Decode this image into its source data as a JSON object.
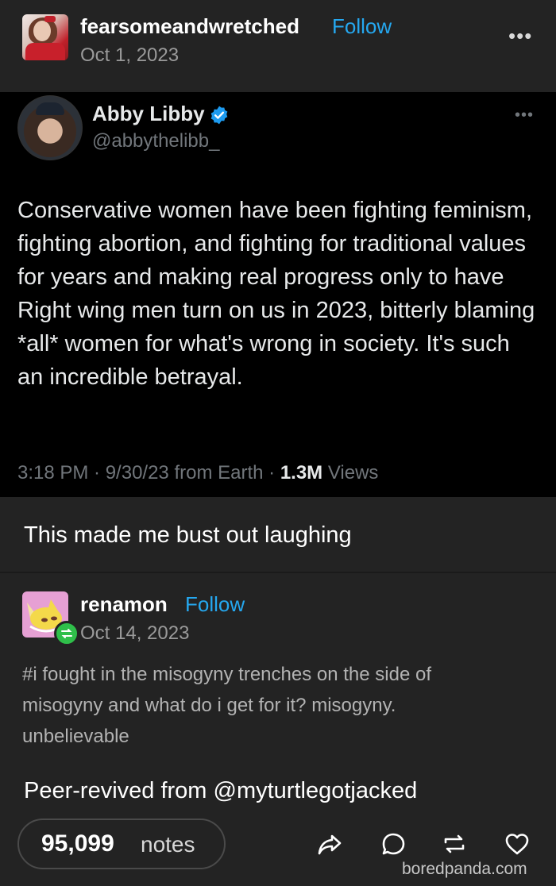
{
  "original_post": {
    "username": "fearsomeandwretched",
    "follow_label": "Follow",
    "date": "Oct 1, 2023",
    "menu_icon": "more-dots-icon"
  },
  "tweet": {
    "display_name": "Abby Libby",
    "handle": "@abbythelibb_",
    "verified_icon": "verified-badge-icon",
    "body": "Conservative women have been fighting feminism, fighting abortion, and fighting for traditional values for years and making real progress only to have Right wing men turn on us in 2023, bitterly blaming *all* women for what's wrong in society. It's such an incredible betrayal.",
    "time_date": "3:18 PM · 9/30/23 from Earth · ",
    "views_count": "1.3M",
    "views_label": " Views"
  },
  "caption": "This made me bust out laughing",
  "reblog": {
    "username": "renamon",
    "follow_label": "Follow",
    "date": "Oct 14, 2023",
    "tags": "#i fought in the misogyny trenches on the side of misogyny and what do i get for it? misogyny. unbelievable"
  },
  "source_line": "Peer-revived from @myturtlegotjacked",
  "footer": {
    "notes_count": "95,099",
    "notes_label": "notes",
    "actions": [
      "share-icon",
      "reply-icon",
      "reblog-icon",
      "like-icon"
    ]
  },
  "watermark": "boredpanda.com",
  "colors": {
    "background": "#232323",
    "tweet_background": "#000000",
    "follow_blue": "#25a8f0",
    "verified_blue": "#1d9bf0",
    "reblog_green": "#2fbf4a"
  }
}
